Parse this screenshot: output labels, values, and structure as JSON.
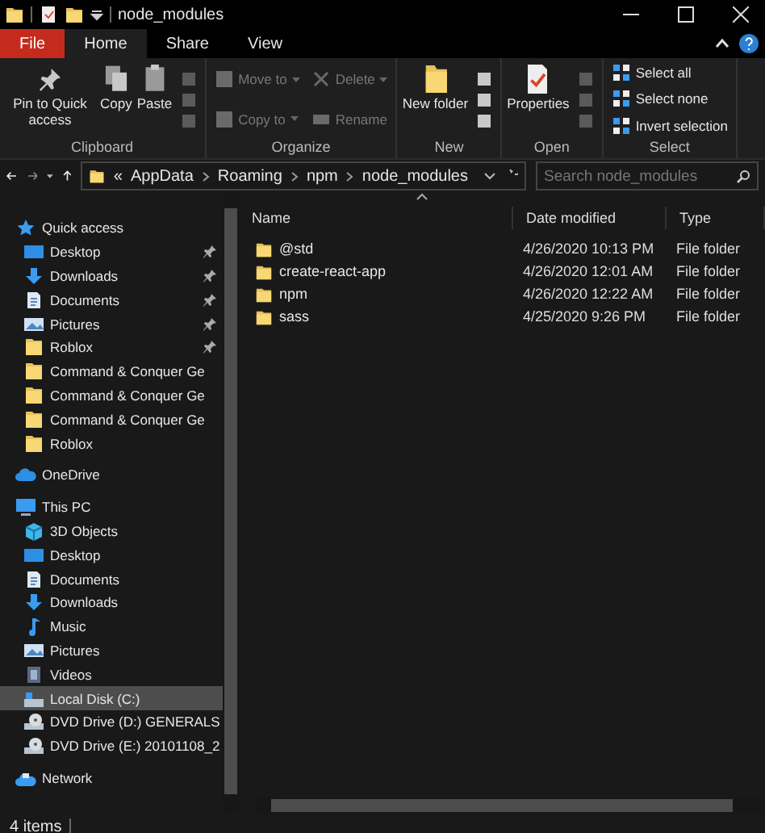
{
  "window": {
    "title": "node_modules"
  },
  "ribbon_tabs": [
    {
      "label": "File",
      "kind": "file",
      "selected": false
    },
    {
      "label": "Home",
      "kind": "tab",
      "selected": true
    },
    {
      "label": "Share",
      "kind": "tab",
      "selected": false
    },
    {
      "label": "View",
      "kind": "tab",
      "selected": false
    }
  ],
  "ribbon_groups": [
    {
      "label": "Clipboard",
      "commands": [
        {
          "label": "Pin to Quick access",
          "kind": "pin",
          "disabled": false
        },
        {
          "label": "Copy",
          "kind": "copy",
          "disabled": false
        },
        {
          "label": "Paste",
          "kind": "paste",
          "disabled": false
        },
        {
          "kind": "small-stack",
          "disabled": true
        }
      ]
    },
    {
      "label": "Organize",
      "commands": [
        {
          "kind": "column",
          "disabled": true,
          "items": [
            {
              "label": "Move to",
              "kind": "move"
            },
            {
              "label": "Copy to",
              "kind": "copyto"
            }
          ]
        },
        {
          "kind": "column",
          "disabled": true,
          "items": [
            {
              "label": "Delete",
              "kind": "delete"
            },
            {
              "label": "Rename",
              "kind": "rename"
            }
          ]
        }
      ]
    },
    {
      "label": "New",
      "commands": [
        {
          "label": "New folder",
          "kind": "newfolder",
          "disabled": false
        },
        {
          "kind": "small-stack",
          "disabled": false
        }
      ]
    },
    {
      "label": "Open",
      "commands": [
        {
          "label": "Properties",
          "kind": "properties",
          "disabled": false
        },
        {
          "kind": "small-stack",
          "disabled": true
        }
      ]
    },
    {
      "label": "Select",
      "commands": [
        {
          "kind": "column",
          "disabled": false,
          "items": [
            {
              "label": "Select all",
              "kind": "select"
            },
            {
              "label": "Select none",
              "kind": "select"
            },
            {
              "label": "Invert selection",
              "kind": "select"
            }
          ]
        }
      ]
    }
  ],
  "address": {
    "overflow": "«",
    "crumbs": [
      "AppData",
      "Roaming",
      "npm",
      "node_modules"
    ]
  },
  "search": {
    "placeholder": "Search node_modules"
  },
  "navigation": [
    {
      "label": "Quick access",
      "kind": "star",
      "selected": false,
      "children": [
        {
          "label": "Desktop",
          "kind": "desktop",
          "pinned": true,
          "selected": false
        },
        {
          "label": "Downloads",
          "kind": "download",
          "pinned": true,
          "selected": false
        },
        {
          "label": "Documents",
          "kind": "document",
          "pinned": true,
          "selected": false
        },
        {
          "label": "Pictures",
          "kind": "pictures",
          "pinned": true,
          "selected": false
        },
        {
          "label": "Roblox",
          "kind": "folder",
          "pinned": true,
          "selected": false
        },
        {
          "label": "Command & Conquer Ge",
          "kind": "folder",
          "pinned": false,
          "selected": false
        },
        {
          "label": "Command & Conquer Ge",
          "kind": "folder",
          "pinned": false,
          "selected": false
        },
        {
          "label": "Command & Conquer Ge",
          "kind": "folder",
          "pinned": false,
          "selected": false
        },
        {
          "label": "Roblox",
          "kind": "folder",
          "pinned": false,
          "selected": false
        }
      ]
    },
    {
      "label": "OneDrive",
      "kind": "cloud",
      "selected": false
    },
    {
      "label": "This PC",
      "kind": "pc",
      "selected": false,
      "children": [
        {
          "label": "3D Objects",
          "kind": "cube",
          "pinned": false,
          "selected": false
        },
        {
          "label": "Desktop",
          "kind": "desktop",
          "pinned": false,
          "selected": false
        },
        {
          "label": "Documents",
          "kind": "document",
          "pinned": false,
          "selected": false
        },
        {
          "label": "Downloads",
          "kind": "download",
          "pinned": false,
          "selected": false
        },
        {
          "label": "Music",
          "kind": "music",
          "pinned": false,
          "selected": false
        },
        {
          "label": "Pictures",
          "kind": "pictures",
          "pinned": false,
          "selected": false
        },
        {
          "label": "Videos",
          "kind": "video",
          "pinned": false,
          "selected": false
        },
        {
          "label": "Local Disk (C:)",
          "kind": "disk",
          "pinned": false,
          "selected": true
        },
        {
          "label": "DVD Drive (D:) GENERALS",
          "kind": "dvd",
          "pinned": false,
          "selected": false
        },
        {
          "label": "DVD Drive (E:) 20101108_2",
          "kind": "dvd",
          "pinned": false,
          "selected": false
        }
      ]
    },
    {
      "label": "Network",
      "kind": "network",
      "selected": false
    }
  ],
  "table": {
    "columns": [
      "Name",
      "Date modified",
      "Type"
    ],
    "rows": [
      {
        "name": "@std",
        "date": "4/26/2020 10:13 PM",
        "type": "File folder"
      },
      {
        "name": "create-react-app",
        "date": "4/26/2020 12:01 AM",
        "type": "File folder"
      },
      {
        "name": "npm",
        "date": "4/26/2020 12:22 AM",
        "type": "File folder"
      },
      {
        "name": "sass",
        "date": "4/25/2020 9:26 PM",
        "type": "File folder"
      }
    ]
  },
  "status_bar": {
    "count": "4 items"
  }
}
